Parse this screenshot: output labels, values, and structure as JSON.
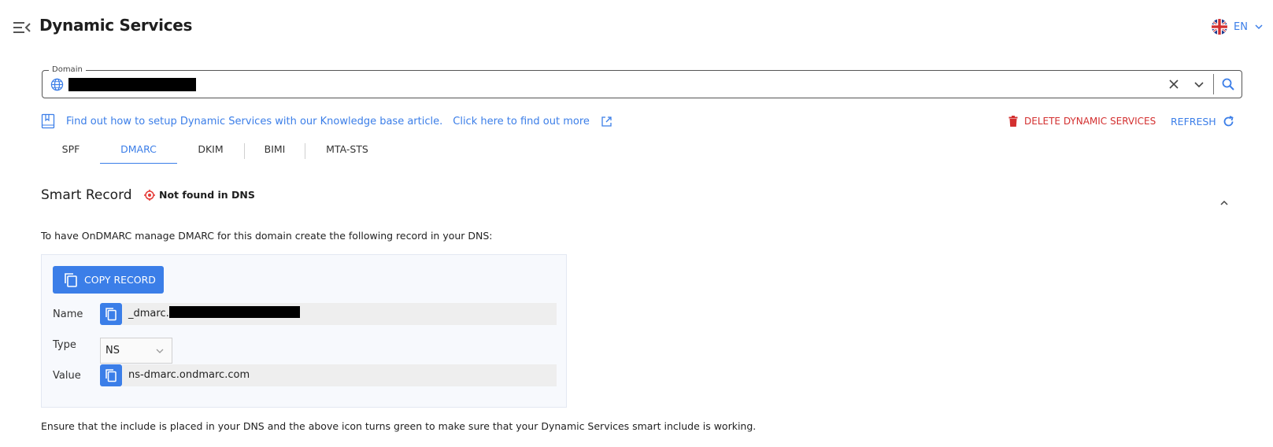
{
  "header": {
    "title": "Dynamic Services",
    "language": "EN"
  },
  "domain": {
    "label": "Domain",
    "value_redacted": true
  },
  "info": {
    "kb_text": "Find out how to setup Dynamic Services with our Knowledge base article.",
    "kb_link": "Click here to find out more"
  },
  "actions": {
    "delete_label": "DELETE DYNAMIC SERVICES",
    "refresh_label": "REFRESH"
  },
  "tabs": [
    {
      "label": "SPF",
      "active": false
    },
    {
      "label": "DMARC",
      "active": true
    },
    {
      "label": "DKIM",
      "active": false
    },
    {
      "label": "BIMI",
      "active": false
    },
    {
      "label": "MTA-STS",
      "active": false
    }
  ],
  "smart_record": {
    "title": "Smart Record",
    "status": "Not found in DNS",
    "status_color": "#e53935",
    "instruction": "To have OnDMARC manage DMARC for this domain create the following record in your DNS:",
    "copy_label": "COPY RECORD",
    "name_label": "Name",
    "name_prefix": "_dmarc.",
    "type_label": "Type",
    "type_value": "NS",
    "value_label": "Value",
    "value": "ns-dmarc.ondmarc.com",
    "footer": "Ensure that the include is placed in your DNS and the above icon turns green to make sure that your Dynamic Services smart include is working."
  },
  "colors": {
    "accent": "#3b7ee8",
    "danger": "#d32f2f"
  }
}
